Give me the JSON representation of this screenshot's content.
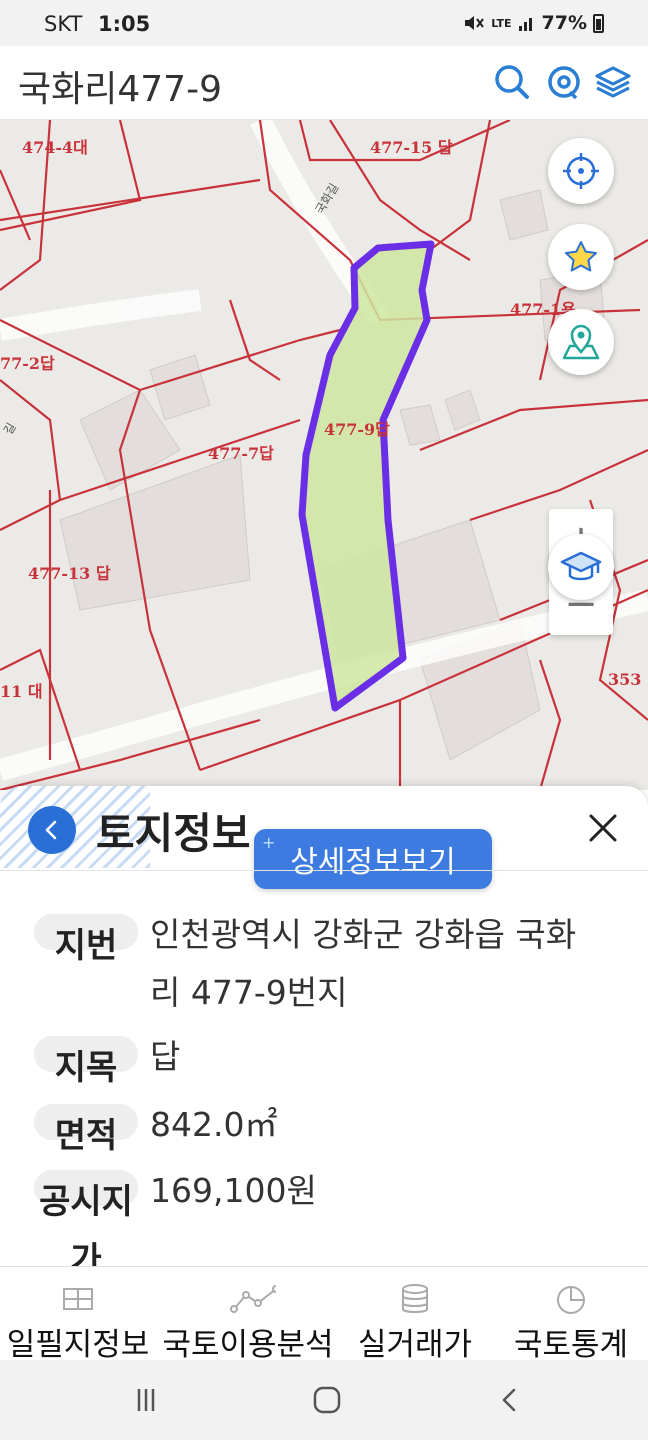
{
  "status_bar": {
    "carrier": "SKT",
    "time": "1:05",
    "network": "LTE",
    "battery": "77%"
  },
  "header": {
    "title": "국화리477-9",
    "accent_color": "#2a7fd4"
  },
  "map": {
    "labels": {
      "l1": "474-4대",
      "l2": "477-15 답",
      "l3": "477-1용",
      "l4": "77-2답",
      "l5": "477-9답",
      "l6": "477-7답",
      "l7": "477-13 답",
      "l8": "11 대",
      "l9": "353",
      "road1": "국화길",
      "road2": "길"
    },
    "parcel_fill": "#cfe6a0",
    "parcel_stroke": "#6a2ee6",
    "boundary_color": "#c8323a",
    "controls": {
      "locate": "gps-target-icon",
      "favorite": "star-icon",
      "map_pin": "map-pin-icon",
      "zoom_in": "+",
      "zoom_out": "−",
      "education": "graduation-cap-icon"
    }
  },
  "sheet": {
    "title": "토지정보",
    "detail_button": "상세정보보기",
    "rows": [
      {
        "key": "지번",
        "value_line1": "인천광역시 강화군 강화읍 국화",
        "value_line2": "리 477-9번지"
      },
      {
        "key": "지목",
        "value_line1": "답"
      },
      {
        "key": "면적",
        "value_line1": "842.0㎡"
      },
      {
        "key_line1": "공시지",
        "key_line2": "가",
        "value_line1": "169,100원"
      }
    ]
  },
  "bottom_nav": [
    {
      "label": "일필지정보",
      "icon": "parcel-grid-icon"
    },
    {
      "label": "국토이용분석",
      "icon": "line-graph-icon"
    },
    {
      "label": "실거래가",
      "icon": "database-icon"
    },
    {
      "label": "국토통계",
      "icon": "pie-chart-icon"
    }
  ]
}
